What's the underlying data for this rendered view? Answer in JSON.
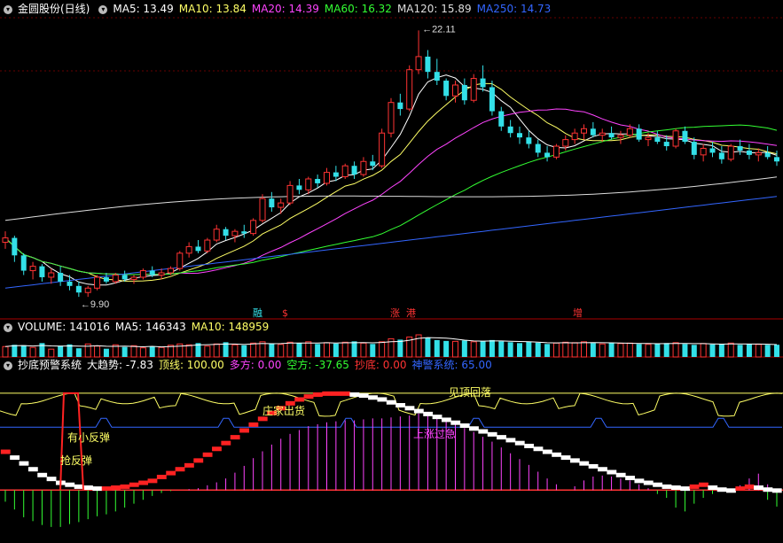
{
  "main_header": {
    "title": "金圆股份(日线)",
    "ma": [
      {
        "label": "MA5: 13.49",
        "color": "#ffffff"
      },
      {
        "label": "MA10: 13.84",
        "color": "#ffff66"
      },
      {
        "label": "MA20: 14.39",
        "color": "#ff44ff"
      },
      {
        "label": "MA60: 16.32",
        "color": "#33ff33"
      },
      {
        "label": "MA120: 15.89",
        "color": "#dddddd"
      },
      {
        "label": "MA250: 14.73",
        "color": "#3366ff"
      }
    ]
  },
  "volume_header": {
    "items": [
      {
        "label": "VOLUME: 141016",
        "color": "#ffffff"
      },
      {
        "label": "MA5: 146343",
        "color": "#ffffff"
      },
      {
        "label": "MA10: 148959",
        "color": "#ffff66"
      }
    ]
  },
  "indicator_header": {
    "items": [
      {
        "label": "抄底预警系统",
        "color": "#ffffff"
      },
      {
        "label": "大趋势: -7.83",
        "color": "#ffffff"
      },
      {
        "label": "顶线: 100.00",
        "color": "#ffff66"
      },
      {
        "label": "多方: 0.00",
        "color": "#ff44ff"
      },
      {
        "label": "空方: -37.65",
        "color": "#33ff33"
      },
      {
        "label": "抄底: 0.00",
        "color": "#ff3333"
      },
      {
        "label": "神警系统: 65.00",
        "color": "#3366ff"
      }
    ]
  },
  "chart_data": [
    {
      "type": "candlestick",
      "title": "金圆股份(日线)",
      "ohlc": [
        [
          12.4,
          12.9,
          12.1,
          12.6
        ],
        [
          12.6,
          12.7,
          11.5,
          11.8
        ],
        [
          11.8,
          11.9,
          10.9,
          11.1
        ],
        [
          11.1,
          11.5,
          10.7,
          11.3
        ],
        [
          11.3,
          11.4,
          10.6,
          10.8
        ],
        [
          10.8,
          11.2,
          10.5,
          11.0
        ],
        [
          11.0,
          11.3,
          10.4,
          10.6
        ],
        [
          10.6,
          10.9,
          10.2,
          10.4
        ],
        [
          10.4,
          10.6,
          9.9,
          10.1
        ],
        [
          10.1,
          10.4,
          9.9,
          10.3
        ],
        [
          10.3,
          10.9,
          10.2,
          10.8
        ],
        [
          10.8,
          11.0,
          10.5,
          10.6
        ],
        [
          10.6,
          11.0,
          10.5,
          10.9
        ],
        [
          10.9,
          11.1,
          10.6,
          10.7
        ],
        [
          10.7,
          10.9,
          10.5,
          10.8
        ],
        [
          10.8,
          11.2,
          10.7,
          11.1
        ],
        [
          11.1,
          11.3,
          10.8,
          10.9
        ],
        [
          10.9,
          11.2,
          10.7,
          11.0
        ],
        [
          11.0,
          11.3,
          10.9,
          11.2
        ],
        [
          11.2,
          12.0,
          11.1,
          11.9
        ],
        [
          11.9,
          12.4,
          11.7,
          12.2
        ],
        [
          12.2,
          12.5,
          11.9,
          12.0
        ],
        [
          12.0,
          12.6,
          11.9,
          12.5
        ],
        [
          12.5,
          13.2,
          12.4,
          13.0
        ],
        [
          13.0,
          13.1,
          12.5,
          12.7
        ],
        [
          12.7,
          13.0,
          12.4,
          12.9
        ],
        [
          12.9,
          13.2,
          12.6,
          12.8
        ],
        [
          12.8,
          13.5,
          12.7,
          13.4
        ],
        [
          13.4,
          14.6,
          13.3,
          14.4
        ],
        [
          14.4,
          14.7,
          13.8,
          14.0
        ],
        [
          14.0,
          14.4,
          13.7,
          14.2
        ],
        [
          14.2,
          15.2,
          14.1,
          15.0
        ],
        [
          15.0,
          15.3,
          14.6,
          14.8
        ],
        [
          14.8,
          15.4,
          14.6,
          15.3
        ],
        [
          15.3,
          15.5,
          14.9,
          15.1
        ],
        [
          15.1,
          15.8,
          15.0,
          15.6
        ],
        [
          15.6,
          15.9,
          15.2,
          15.4
        ],
        [
          15.4,
          16.0,
          15.3,
          15.9
        ],
        [
          15.9,
          16.1,
          15.3,
          15.5
        ],
        [
          15.5,
          16.3,
          15.4,
          16.1
        ],
        [
          16.1,
          16.4,
          15.7,
          15.9
        ],
        [
          15.9,
          17.6,
          15.8,
          17.4
        ],
        [
          17.4,
          19.0,
          17.2,
          18.8
        ],
        [
          18.8,
          19.2,
          18.2,
          18.5
        ],
        [
          18.5,
          20.5,
          18.4,
          20.3
        ],
        [
          20.3,
          22.1,
          20.1,
          20.9
        ],
        [
          20.9,
          21.2,
          19.9,
          20.2
        ],
        [
          20.2,
          20.8,
          19.6,
          19.8
        ],
        [
          19.8,
          19.9,
          18.9,
          19.1
        ],
        [
          19.1,
          19.8,
          18.8,
          19.6
        ],
        [
          19.6,
          19.9,
          18.7,
          18.9
        ],
        [
          18.9,
          20.1,
          18.8,
          19.9
        ],
        [
          19.9,
          20.5,
          19.3,
          19.5
        ],
        [
          19.5,
          19.8,
          18.2,
          18.4
        ],
        [
          18.4,
          18.6,
          17.5,
          17.7
        ],
        [
          17.7,
          18.0,
          17.2,
          17.4
        ],
        [
          17.4,
          17.7,
          16.9,
          17.2
        ],
        [
          17.2,
          17.5,
          16.7,
          16.9
        ],
        [
          16.9,
          17.1,
          16.3,
          16.5
        ],
        [
          16.5,
          16.8,
          16.1,
          16.3
        ],
        [
          16.3,
          16.9,
          16.2,
          16.8
        ],
        [
          16.8,
          17.3,
          16.6,
          17.1
        ],
        [
          17.1,
          17.6,
          16.9,
          17.4
        ],
        [
          17.4,
          17.8,
          17.1,
          17.6
        ],
        [
          17.6,
          17.9,
          17.2,
          17.3
        ],
        [
          17.3,
          17.6,
          17.0,
          17.4
        ],
        [
          17.4,
          17.7,
          17.1,
          17.2
        ],
        [
          17.2,
          17.5,
          16.9,
          17.3
        ],
        [
          17.3,
          17.8,
          17.2,
          17.6
        ],
        [
          17.6,
          17.8,
          17.0,
          17.1
        ],
        [
          17.1,
          17.4,
          16.8,
          17.2
        ],
        [
          17.2,
          17.5,
          16.9,
          17.0
        ],
        [
          17.0,
          17.3,
          16.6,
          16.8
        ],
        [
          16.8,
          17.6,
          16.7,
          17.5
        ],
        [
          17.5,
          17.7,
          16.9,
          17.0
        ],
        [
          17.0,
          17.2,
          16.2,
          16.4
        ],
        [
          16.4,
          16.9,
          16.1,
          16.7
        ],
        [
          16.7,
          17.0,
          16.3,
          16.5
        ],
        [
          16.5,
          16.8,
          16.0,
          16.2
        ],
        [
          16.2,
          16.9,
          16.1,
          16.8
        ],
        [
          16.8,
          17.1,
          16.4,
          16.6
        ],
        [
          16.6,
          16.9,
          16.2,
          16.4
        ],
        [
          16.4,
          16.7,
          16.1,
          16.5
        ],
        [
          16.5,
          16.8,
          16.2,
          16.3
        ],
        [
          16.3,
          16.6,
          15.9,
          16.1
        ]
      ],
      "annotations": [
        {
          "label": "22.11",
          "value": 22.11
        },
        {
          "label": "9.90",
          "value": 9.9
        }
      ],
      "markers": [
        "融",
        "$",
        "涨",
        "港",
        "增"
      ],
      "lines": [
        {
          "name": "MA5",
          "color": "#ffffff"
        },
        {
          "name": "MA10",
          "color": "#ffff66"
        },
        {
          "name": "MA20",
          "color": "#ff44ff"
        },
        {
          "name": "MA60",
          "color": "#33ff33"
        },
        {
          "name": "MA120",
          "color": "#dddddd"
        },
        {
          "name": "MA250",
          "color": "#3366ff"
        }
      ]
    },
    {
      "type": "bar",
      "title": "VOLUME",
      "values": [
        120,
        140,
        135,
        110,
        160,
        90,
        130,
        145,
        100,
        150,
        125,
        95,
        140,
        115,
        130,
        105,
        120,
        110,
        135,
        150,
        140,
        160,
        125,
        150,
        170,
        140,
        135,
        160,
        175,
        155,
        145,
        170,
        160,
        175,
        150,
        165,
        155,
        170,
        180,
        160,
        150,
        175,
        210,
        200,
        230,
        255,
        220,
        195,
        185,
        180,
        190,
        175,
        185,
        195,
        180,
        170,
        160,
        175,
        165,
        150,
        160,
        170,
        165,
        175,
        160,
        150,
        165,
        155,
        160,
        150,
        145,
        155,
        160,
        165,
        150,
        140,
        155,
        145,
        150,
        160,
        140,
        150,
        145,
        140,
        141
      ]
    },
    {
      "type": "area",
      "title": "抄底预警系统",
      "ylim": [
        -50,
        120
      ],
      "bull": [
        0,
        0,
        0,
        0,
        0,
        0,
        0,
        0,
        0,
        0,
        0,
        0,
        0,
        0,
        0,
        0,
        0,
        0,
        0,
        0,
        1,
        2,
        5,
        8,
        12,
        18,
        25,
        33,
        40,
        47,
        53,
        58,
        62,
        66,
        68,
        70,
        71,
        72,
        72,
        73,
        74,
        74,
        75,
        76,
        77,
        79,
        80,
        76,
        72,
        68,
        64,
        60,
        55,
        50,
        44,
        38,
        32,
        26,
        19,
        12,
        6,
        0,
        4,
        10,
        14,
        15,
        14,
        12,
        10,
        6,
        2,
        0,
        0,
        0,
        0,
        0,
        0,
        0,
        0,
        0,
        5,
        12,
        17,
        6,
        0
      ],
      "bear": [
        -12,
        -20,
        -28,
        -32,
        -36,
        -38,
        -38,
        -35,
        -33,
        -30,
        -27,
        -25,
        -22,
        -18,
        -14,
        -10,
        -6,
        -3,
        -1,
        0,
        0,
        0,
        0,
        0,
        0,
        0,
        0,
        0,
        0,
        0,
        0,
        0,
        0,
        0,
        0,
        0,
        0,
        0,
        0,
        0,
        0,
        0,
        0,
        0,
        0,
        0,
        0,
        0,
        0,
        0,
        0,
        0,
        0,
        0,
        0,
        0,
        0,
        0,
        0,
        0,
        0,
        0,
        0,
        0,
        0,
        0,
        0,
        0,
        0,
        0,
        0,
        -4,
        -8,
        -18,
        -22,
        -14,
        -8,
        -4,
        0,
        0,
        0,
        0,
        0,
        -10,
        -17
      ],
      "trend": [
        40,
        34,
        28,
        22,
        16,
        12,
        8,
        6,
        4,
        3,
        2,
        2,
        3,
        4,
        6,
        8,
        10,
        14,
        18,
        22,
        26,
        31,
        37,
        43,
        49,
        55,
        62,
        68,
        74,
        80,
        85,
        90,
        94,
        97,
        99,
        100,
        100,
        100,
        99,
        98,
        96,
        94,
        91,
        88,
        85,
        82,
        79,
        76,
        73,
        70,
        67,
        64,
        61,
        58,
        55,
        52,
        49,
        46,
        43,
        40,
        37,
        34,
        31,
        28,
        25,
        22,
        19,
        16,
        13,
        10,
        8,
        6,
        4,
        3,
        2,
        4,
        6,
        3,
        1,
        0,
        2,
        4,
        3,
        1,
        0
      ],
      "top_line": 100,
      "alert_line": 65,
      "texts": [
        "有小反弹",
        "抢反弹",
        "庄家出货",
        "上涨过急",
        "见顶回落"
      ]
    }
  ]
}
